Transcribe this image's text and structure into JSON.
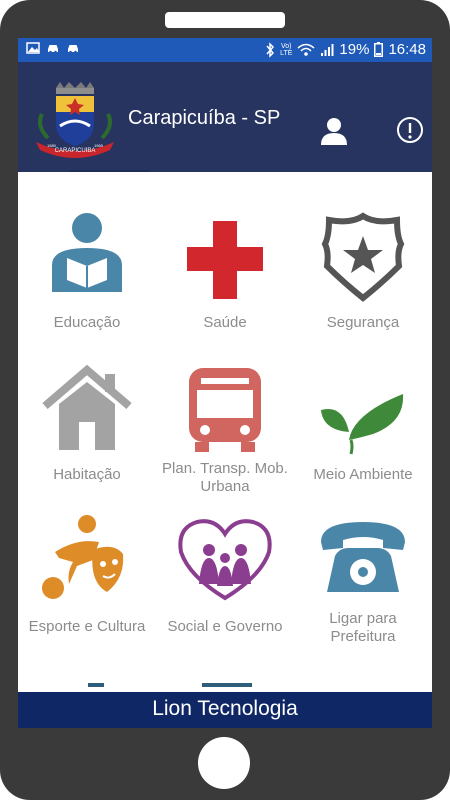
{
  "status_bar": {
    "left_icons": [
      "image-icon",
      "car-icon",
      "car-icon"
    ],
    "network_label_top": "Vo)",
    "network_label_bottom": "LTE",
    "battery_percent": "19%",
    "time": "16:48"
  },
  "app_bar": {
    "title": "Carapicuíba - SP",
    "seal_text": "CARAPICUIBA",
    "seal_year_left": "1580",
    "seal_year_right": "1965"
  },
  "menu": {
    "items": [
      {
        "label": "Educação",
        "icon": "reading-person-icon",
        "color": "#4a86a8"
      },
      {
        "label": "Saúde",
        "icon": "red-cross-icon",
        "color": "#d3272e"
      },
      {
        "label": "Segurança",
        "icon": "police-badge-icon",
        "color": "#555555"
      },
      {
        "label": "Habitação",
        "icon": "house-icon",
        "color": "#a3a3a3"
      },
      {
        "label": "Plan. Transp. Mob. Urbana",
        "icon": "bus-icon",
        "color": "#d0665f"
      },
      {
        "label": "Meio Ambiente",
        "icon": "leaves-icon",
        "color": "#3f8a3a"
      },
      {
        "label": "Esporte e Cultura",
        "icon": "sport-culture-icon",
        "color": "#dd8c27"
      },
      {
        "label": "Social e Governo",
        "icon": "family-heart-icon",
        "color": "#8b3e8f"
      },
      {
        "label": "Ligar para Prefeitura",
        "icon": "telephone-icon",
        "color": "#4a86a8"
      }
    ]
  },
  "footer": {
    "text": "Lion Tecnologia"
  }
}
